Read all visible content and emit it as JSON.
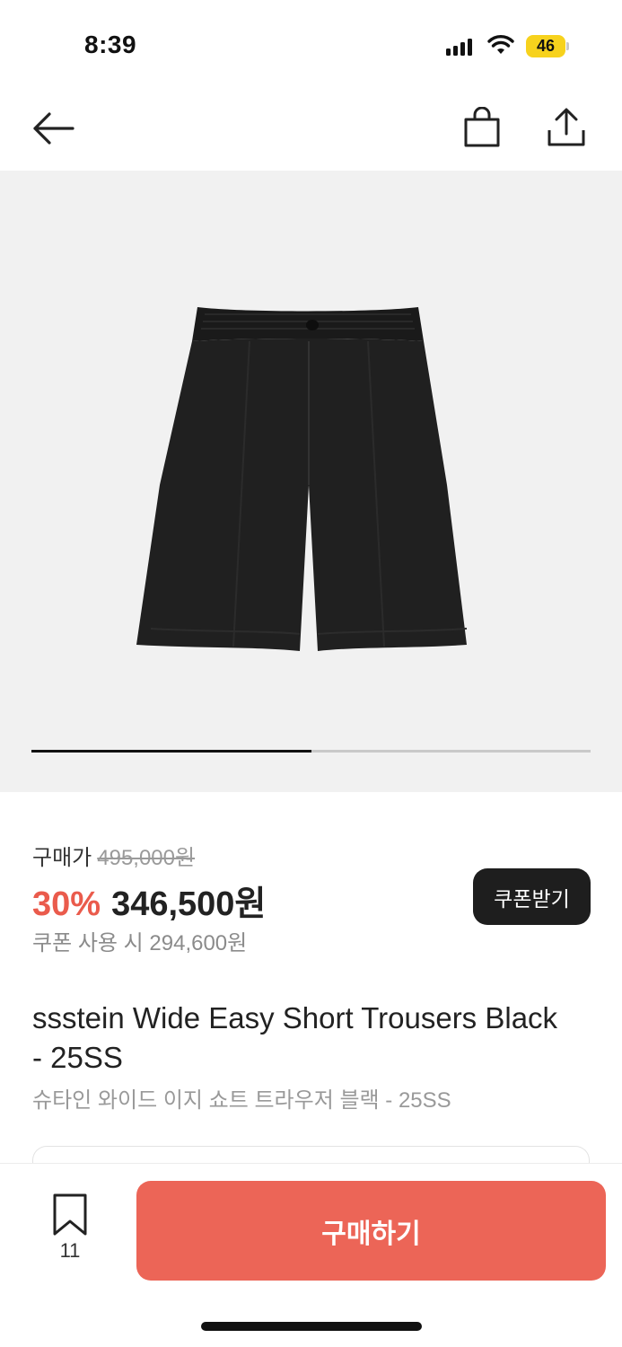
{
  "status_bar": {
    "time": "8:39",
    "battery": "46",
    "icons": [
      "signal-icon",
      "wifi-icon",
      "battery-icon"
    ]
  },
  "nav": {
    "icons": [
      "back-arrow-icon",
      "shopping-bag-icon",
      "share-icon"
    ]
  },
  "gallery": {
    "progress": 0.5,
    "image": "black-wide-shorts"
  },
  "price": {
    "label": "구매가",
    "original": "495,000원",
    "discount": "30%",
    "sale": "346,500원",
    "coupon_text": "쿠폰 사용 시 294,600원",
    "coupon_button": "쿠폰받기"
  },
  "product": {
    "title": "ssstein Wide Easy Short Trousers Black - 25SS",
    "subtitle": "슈타인 와이드 이지 쇼트 트라우저 블랙 - 25SS"
  },
  "bottom": {
    "bookmark_count": "11",
    "buy_label": "구매하기"
  },
  "colors": {
    "accent": "#ec6557",
    "discount": "#ea5b4c",
    "battery": "#f7d21d",
    "dark_button": "#1e1e1e"
  }
}
